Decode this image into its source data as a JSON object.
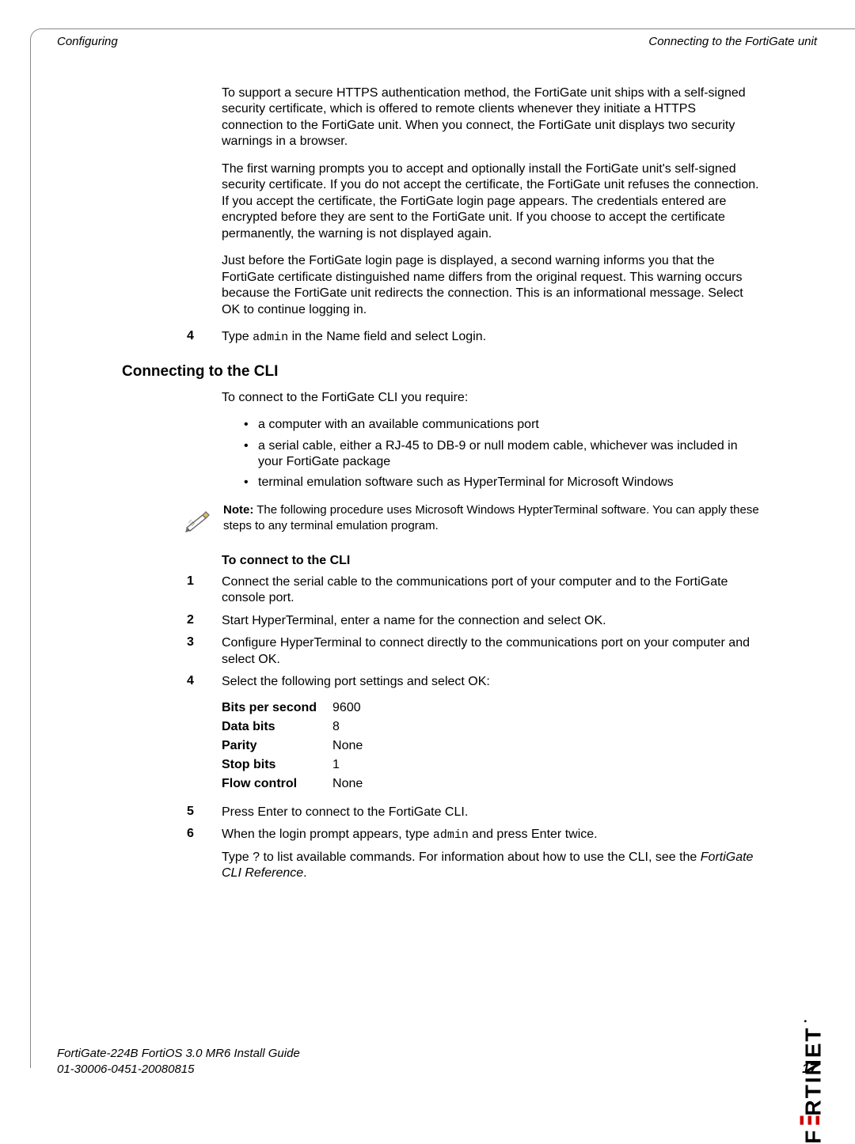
{
  "header": {
    "left": "Configuring",
    "right": "Connecting to the FortiGate unit"
  },
  "intro": {
    "p1": "To support a secure HTTPS authentication method, the FortiGate unit ships with a self-signed security certificate, which is offered to remote clients whenever they initiate a HTTPS connection to the FortiGate unit. When you connect, the FortiGate unit displays two security warnings in a browser.",
    "p2": "The first warning prompts you to accept and optionally install the FortiGate unit's self-signed security certificate. If you do not accept the certificate, the FortiGate unit refuses the connection. If you accept the certificate, the FortiGate login page appears. The credentials entered are encrypted before they are sent to the FortiGate unit. If you choose to accept the certificate permanently, the warning is not displayed again.",
    "p3": "Just before the FortiGate login page is displayed, a second warning informs you that the FortiGate certificate distinguished name differs from the original request. This warning occurs because the FortiGate unit redirects the connection. This is an informational message. Select OK to continue logging in."
  },
  "step4_upper": {
    "num": "4",
    "pre": "Type ",
    "code": "admin",
    "post": " in the Name field and select Login."
  },
  "h2": "Connecting to the CLI",
  "req_intro": "To connect to the FortiGate CLI you require:",
  "req": [
    "a computer with an available communications port",
    "a serial cable, either a RJ-45 to DB-9 or null modem cable, whichever was included in your FortiGate package",
    "terminal emulation software such as HyperTerminal for Microsoft Windows"
  ],
  "note": {
    "label": "Note:",
    "text": " The following procedure uses Microsoft Windows HypterTerminal software. You can apply these steps to any terminal emulation program."
  },
  "subhead": "To connect to the CLI",
  "steps": {
    "s1": {
      "num": "1",
      "text": "Connect the serial cable to the communications port of your computer and to the FortiGate console port."
    },
    "s2": {
      "num": "2",
      "text": "Start HyperTerminal, enter a name for the connection and select OK."
    },
    "s3": {
      "num": "3",
      "text": "Configure HyperTerminal to connect directly to the communications port on your computer and select OK."
    },
    "s4": {
      "num": "4",
      "text": "Select the following port settings and select OK:"
    },
    "s5": {
      "num": "5",
      "text": "Press Enter to connect to the FortiGate CLI."
    },
    "s6": {
      "num": "6",
      "pre": "When the login prompt appears, type ",
      "code": "admin",
      "post": " and press Enter twice."
    }
  },
  "port": [
    {
      "k": "Bits per second",
      "v": "9600"
    },
    {
      "k": "Data bits",
      "v": "8"
    },
    {
      "k": "Parity",
      "v": "None"
    },
    {
      "k": "Stop bits",
      "v": "1"
    },
    {
      "k": "Flow control",
      "v": "None"
    }
  ],
  "tail": {
    "pre": "Type ? to list available commands. For information about how to use the CLI, see the ",
    "ref": "FortiGate CLI Reference",
    "post": "."
  },
  "footer": {
    "line1": "FortiGate-224B FortiOS 3.0 MR6 Install Guide",
    "line2": "01-30006-0451-20080815",
    "page": "17"
  },
  "brand": {
    "left": "F",
    "right": "RTINET"
  }
}
